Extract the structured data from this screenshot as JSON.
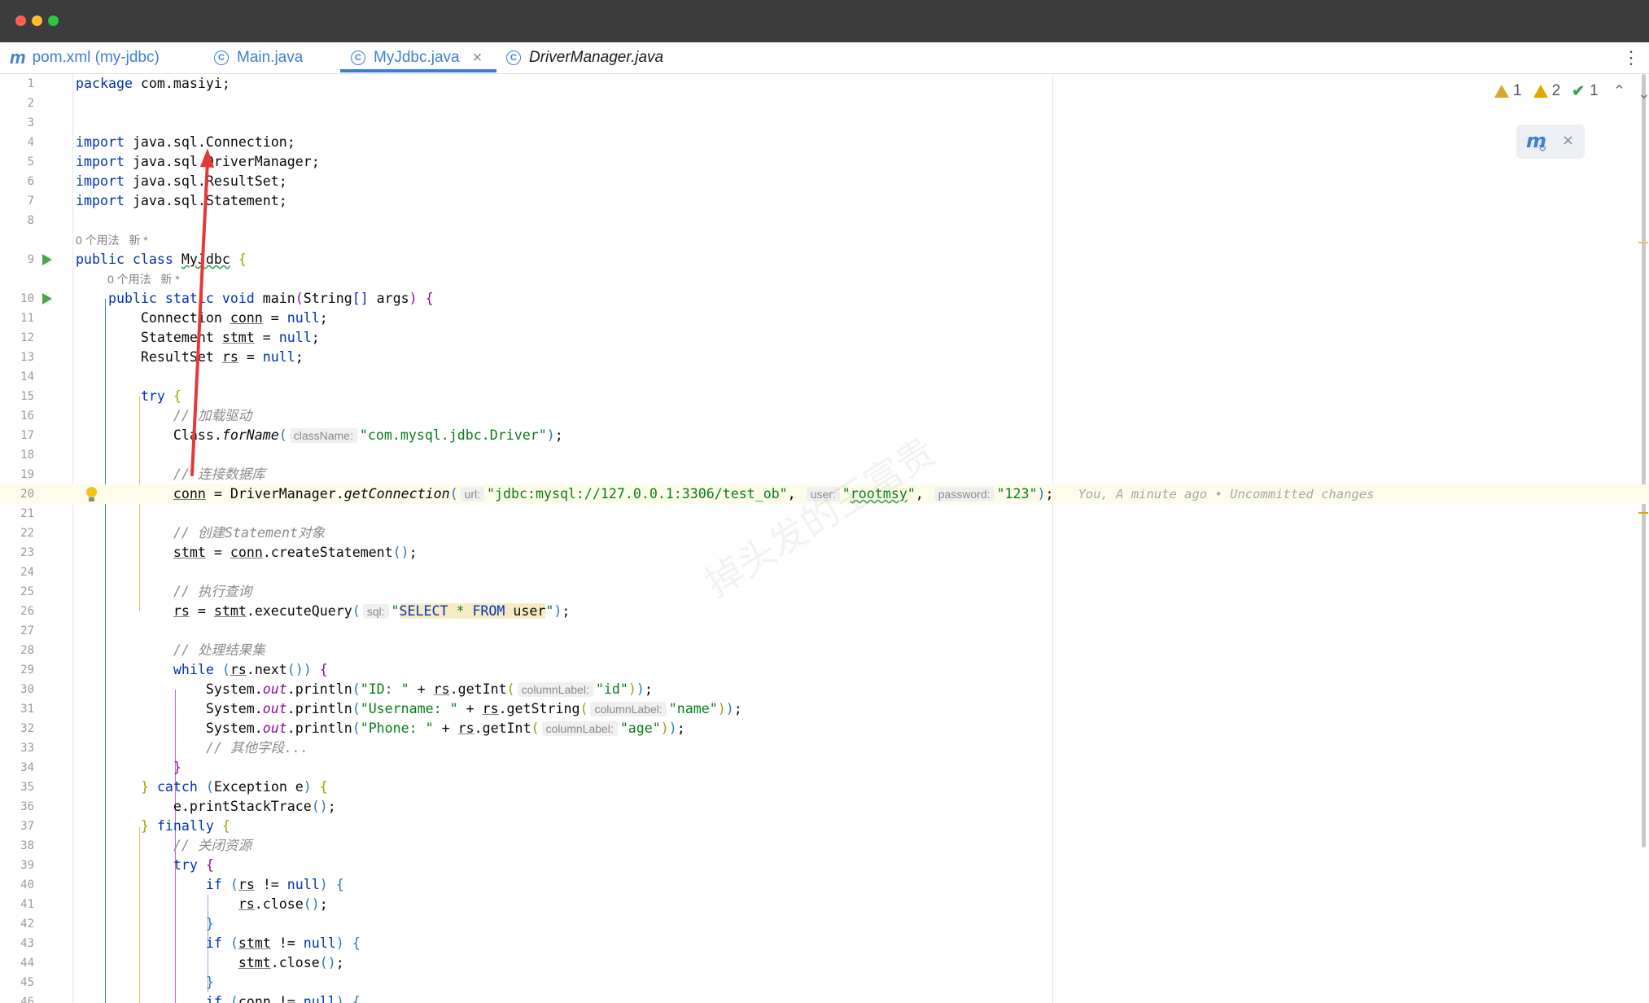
{
  "tabs": [
    {
      "label": "pom.xml (my-jdbc)",
      "icon": "maven-m-icon"
    },
    {
      "label": "Main.java",
      "icon": "class-icon"
    },
    {
      "label": "MyJdbc.java",
      "icon": "class-icon",
      "active": true,
      "close": "×"
    },
    {
      "label": "DriverManager.java",
      "icon": "class-icon"
    }
  ],
  "tabs_menu_glyph": "⋮",
  "inspections": {
    "weak_warnings": "1",
    "warnings": "2",
    "typos": "1"
  },
  "watermark": "掉头发的王富贵",
  "code_hints": {
    "usages_class": "0 个用法   新 *",
    "usages_method": "0 个用法   新 *"
  },
  "blame_line_20": "You, A minute ago • Uncommitted changes",
  "line_numbers": [
    "1",
    "2",
    "3",
    "4",
    "5",
    "6",
    "7",
    "8",
    "9",
    "10",
    "11",
    "12",
    "13",
    "14",
    "15",
    "16",
    "17",
    "18",
    "19",
    "20",
    "21",
    "22",
    "23",
    "24",
    "25",
    "26",
    "27",
    "28",
    "29",
    "30",
    "31",
    "32",
    "33",
    "34",
    "35",
    "36",
    "37",
    "38",
    "39",
    "40",
    "41",
    "42",
    "43",
    "44",
    "45",
    "46"
  ],
  "colors": {
    "keyword": "#0033b3",
    "string": "#067d17",
    "comment": "#8c8c8c",
    "field": "#871094",
    "accent": "#3d7fd8",
    "arrow": "#e53935",
    "run": "#49a64f"
  }
}
